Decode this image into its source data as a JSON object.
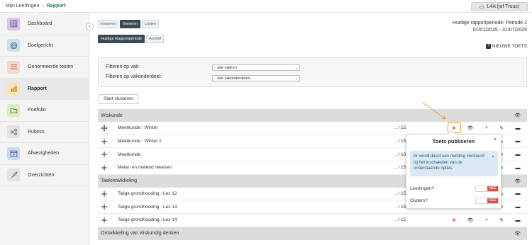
{
  "breadcrumb": {
    "parent": "Mijn Leerlingen",
    "current": "Rapport"
  },
  "user": {
    "label": "L4A (juf Truus)"
  },
  "sidebar": {
    "items": [
      {
        "label": "Dashboard",
        "icon": "grid-icon",
        "color": "#d9c6e8"
      },
      {
        "label": "Doelgericht",
        "icon": "target-icon",
        "color": "#cfe0ea"
      },
      {
        "label": "Genormeerde testen",
        "icon": "list-icon",
        "color": "#f3d9cf"
      },
      {
        "label": "Rapport",
        "icon": "chart-icon",
        "color": "#f6e3b8"
      },
      {
        "label": "Portfolio",
        "icon": "folder-icon",
        "color": "#dcecc6"
      },
      {
        "label": "Rubrics",
        "icon": "share-icon",
        "color": "#e3e3e3"
      },
      {
        "label": "Afwezigheden",
        "icon": "calendar-icon",
        "color": "#cdd9ee"
      },
      {
        "label": "Overzichten",
        "icon": "rocket-icon",
        "color": "#e3e3e3"
      }
    ]
  },
  "tabs": {
    "t1": "Invoeren",
    "t2": "Beheren",
    "t3": "Lijsten",
    "p1": "Huidige Rapportperiode",
    "p2": "Archief"
  },
  "period": {
    "line1": "Huidige rapportperiode: Periode 2",
    "line2": "01/01/2025 - 31/07/2025"
  },
  "new_test": "NIEUWE TOETS",
  "filters": {
    "vak_label": "Filteren op vak:",
    "vak_value": "- alle vakken -",
    "vakonderdeel_label": "Filteren op vakonderdeel:",
    "vakonderdeel_value": "- alle vakonderdelen -"
  },
  "start_button": "Start clusteren",
  "groups": {
    "g1": "Wiskunde",
    "g2": "Taalontwikkeling",
    "g3": "Ontwikkeling van wiskundig denken"
  },
  "rows": {
    "r1": {
      "name": "Meetkunde : Winter",
      "score": ".. / 15"
    },
    "r2": {
      "name": "Meetkunde : Winter 2",
      "score": ".. / 15"
    },
    "r3": {
      "name": "Meetkunde",
      "score": ".. / 10"
    },
    "r4": {
      "name": "Meten en metend rekenen",
      "score": ".. / 15"
    },
    "r5": {
      "name": "Talige grondhouding : Les 12",
      "score": ".. / 15"
    },
    "r6": {
      "name": "Talige grondhouding : Les 13",
      "score": ".. / 15"
    },
    "r7": {
      "name": "Talige grondhouding : Les 14",
      "score": ".. / 15"
    }
  },
  "popup": {
    "title": "Toets publiceren",
    "info": "Er wordt direct een melding verstuurd bij het inschakelen van de onderstaande opties.",
    "leerlingen_label": "Leerlingen?",
    "ouders_label": "Ouders?",
    "toggle_off": "NEE"
  },
  "colors": {
    "accent": "#2d7a6a",
    "highlight": "#f29b38",
    "danger": "#d9534f"
  }
}
